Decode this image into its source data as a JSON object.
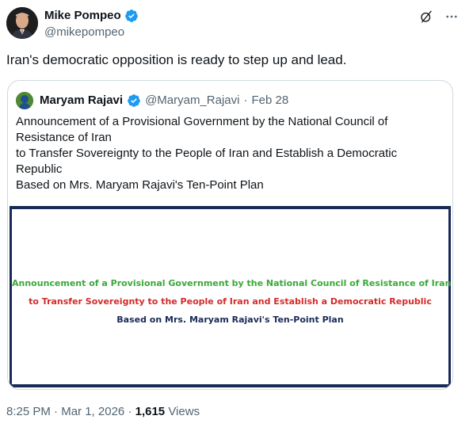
{
  "author": {
    "name": "Mike Pompeo",
    "handle": "@mikepompeo"
  },
  "icons": {
    "grok": "grok-slash-icon",
    "more": "more-dots-icon",
    "verified": "verified-badge-icon"
  },
  "tweet": {
    "text": "Iran's democratic opposition is ready to step up and lead."
  },
  "quote": {
    "name": "Maryam Rajavi",
    "handle": "@Maryam_Rajavi",
    "separator": "·",
    "date": "Feb 28",
    "lines": [
      "Announcement of a Provisional Government by the National Council of Resistance of Iran",
      "to Transfer Sovereignty to the People of Iran and Establish a Democratic Republic",
      "Based on Mrs. Maryam Rajavi's Ten-Point Plan"
    ],
    "media": {
      "line1": "Announcement of a Provisional Government by the National Council of Resistance of Iran",
      "line2": "to Transfer Sovereignty to the People of Iran and Establish a Democratic Republic",
      "line3": "Based on Mrs. Maryam Rajavi's Ten-Point Plan",
      "colors": {
        "line1": "#3aa83a",
        "line2": "#d42a2a",
        "line3": "#1a2a57",
        "frame": "#1a2a57"
      }
    }
  },
  "meta": {
    "time": "8:25 PM",
    "separator": "·",
    "date": "Mar 1, 2026",
    "separator2": "·",
    "views_count": "1,615",
    "views_label": "Views"
  },
  "colors": {
    "verified": "#1d9bf0",
    "secondary_text": "#536471",
    "border": "#cfd9de"
  }
}
